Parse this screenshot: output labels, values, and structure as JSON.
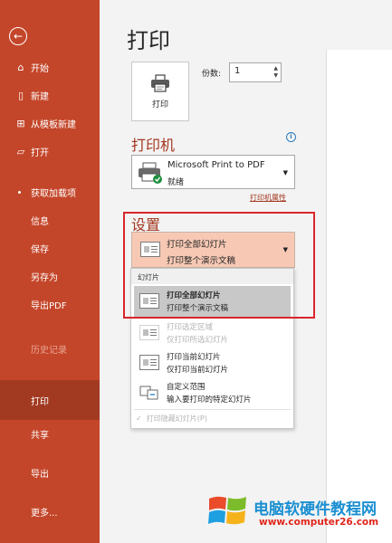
{
  "sidebar": {
    "back_icon": "arrow-left-icon",
    "items": [
      {
        "label": "开始",
        "icon": "home-icon"
      },
      {
        "label": "新建",
        "icon": "new-file-icon"
      },
      {
        "label": "从模板新建",
        "icon": "template-icon"
      },
      {
        "label": "打开",
        "icon": "folder-open-icon"
      },
      {
        "label": "获取加载项"
      },
      {
        "label": "信息"
      },
      {
        "label": "保存"
      },
      {
        "label": "另存为"
      },
      {
        "label": "导出PDF"
      },
      {
        "label": "历史记录"
      },
      {
        "label": "打印"
      },
      {
        "label": "共享"
      },
      {
        "label": "导出"
      },
      {
        "label": "更多..."
      }
    ]
  },
  "main": {
    "title": "打印",
    "print_button": "打印",
    "copies_label": "份数:",
    "copies_value": "1",
    "printer_heading": "打印机",
    "printer_name": "Microsoft Print to PDF",
    "printer_status": "就绪",
    "printer_props": "打印机属性",
    "settings_heading": "设置",
    "settings_title": "打印全部幻灯片",
    "settings_sub": "打印整个演示文稿"
  },
  "dropdown": {
    "header": "幻灯片",
    "items": [
      {
        "title": "打印全部幻灯片",
        "sub": "打印整个演示文稿"
      },
      {
        "title": "打印选定区域",
        "sub": "仅打印所选幻灯片"
      },
      {
        "title": "打印当前幻灯片",
        "sub": "仅打印当前幻灯片"
      },
      {
        "title": "自定义范围",
        "sub": "输入要打印的特定幻灯片"
      }
    ],
    "hidden_option": "打印隐藏幻灯片(P)"
  },
  "watermark": {
    "title": "电脑软硬件教程网",
    "url": "www.computer26.com"
  },
  "colors": {
    "sidebar": "#c4462a",
    "sidebar_active": "#a23a22",
    "accent_text": "#a4371f",
    "settings_fill": "#f7c9b4",
    "highlight_border": "#d9262b"
  }
}
